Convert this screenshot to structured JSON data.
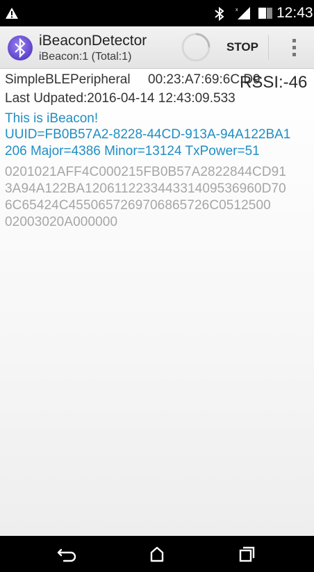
{
  "status_bar": {
    "time": "12:43",
    "icons": [
      "warning-icon",
      "bluetooth-icon",
      "signal-icon",
      "battery-icon"
    ]
  },
  "action_bar": {
    "title": "iBeaconDetector",
    "subtitle": "iBeacon:1 (Total:1)",
    "stop_label": "STOP",
    "icons": [
      "bluetooth-app-icon",
      "progress-spinner",
      "overflow-menu-icon"
    ]
  },
  "device": {
    "name": "SimpleBLEPeripheral",
    "address": "00:23:A7:69:6C:D9",
    "rssi": "RSSI:-46",
    "last_updated": "Last Udpated:2016-04-14 12:43:09.533",
    "beacon_lines": [
      "This is iBeacon!",
      "UUID=FB0B57A2-8228-44CD-913A-94A122BA1",
      "206 Major=4386 Minor=13124 TxPower=51"
    ],
    "raw_lines": [
      "0201021AFF4C000215FB0B57A2822844CD91",
      "3A94A122BA120611223344331409536960D70",
      "6C65424C4550657269706865726C0512500",
      "02003020A000000"
    ]
  },
  "nav_bar": {
    "icons": [
      "back-icon",
      "home-icon",
      "recents-icon"
    ]
  },
  "colors": {
    "beacon_text": "#1f8ec4",
    "raw_text": "#a6a6a6",
    "app_icon": "#6b4fd8"
  }
}
